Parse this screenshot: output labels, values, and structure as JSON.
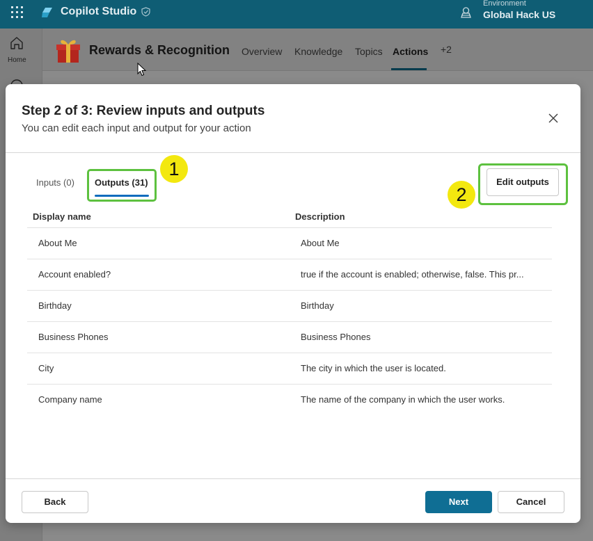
{
  "app": {
    "name": "Copilot Studio",
    "environment_label": "Environment",
    "environment_value": "Global Hack US"
  },
  "rail": {
    "home_label": "Home"
  },
  "agent": {
    "name": "Rewards & Recognition",
    "tabs": [
      {
        "label": "Overview"
      },
      {
        "label": "Knowledge"
      },
      {
        "label": "Topics"
      },
      {
        "label": "Actions",
        "active": true
      },
      {
        "label": "+2"
      }
    ]
  },
  "dialog": {
    "title": "Step 2 of 3: Review inputs and outputs",
    "subtitle": "You can edit each input and output for your action",
    "tabs": {
      "inputs": "Inputs (0)",
      "outputs": "Outputs (31)"
    },
    "edit_button": "Edit outputs",
    "columns": {
      "name": "Display name",
      "description": "Description"
    },
    "rows": [
      {
        "name": "About Me",
        "description": "About Me"
      },
      {
        "name": "Account enabled?",
        "description": "true if the account is enabled; otherwise, false. This pr..."
      },
      {
        "name": "Birthday",
        "description": "Birthday"
      },
      {
        "name": "Business Phones",
        "description": "Business Phones"
      },
      {
        "name": "City",
        "description": "The city in which the user is located."
      },
      {
        "name": "Company name",
        "description": "The name of the company in which the user works."
      }
    ],
    "buttons": {
      "back": "Back",
      "next": "Next",
      "cancel": "Cancel"
    }
  },
  "annotations": {
    "badge_1": "1",
    "badge_2": "2"
  },
  "colors": {
    "top_bar": "#0f5d74",
    "highlight_box": "#5dc13f",
    "badge": "#f3e80f",
    "primary_button": "#0f6e94",
    "tab_underline": "#0f6cbd"
  }
}
